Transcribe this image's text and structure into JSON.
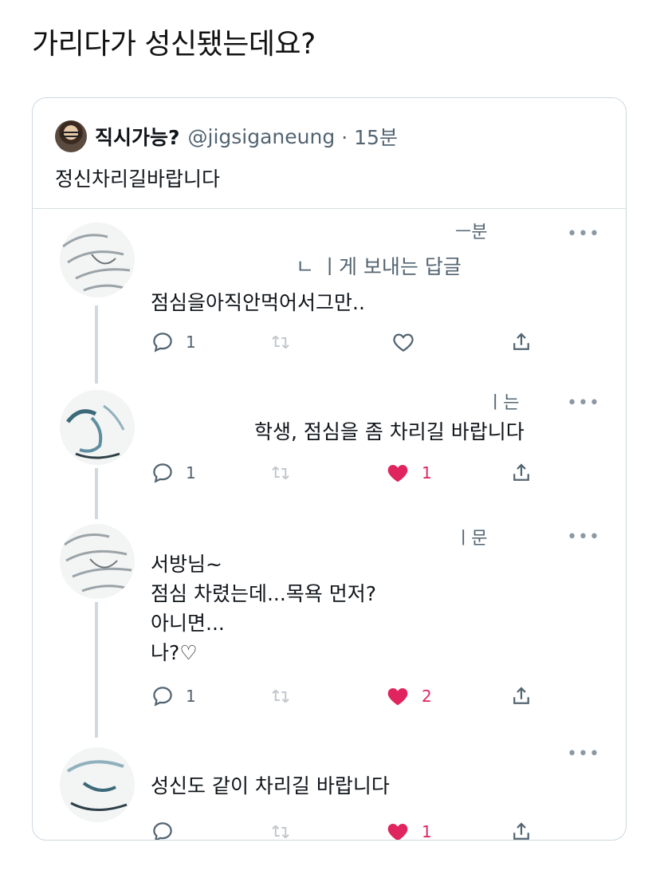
{
  "page_title": "가리다가 성신됐는데요?",
  "quoted_tweet": {
    "name": "직시가능?",
    "handle": "@jigsiganeung",
    "time": "· 15분",
    "text": "정신차리길바랍니다"
  },
  "replies": [
    {
      "time_fragment": "ㅡ분",
      "meta_line": "ㄴ ㅣ게 보내는 답글",
      "text": "점심을아직안먹어서그만..",
      "reply_count": "1",
      "like_count": "",
      "liked": false
    },
    {
      "time_fragment": "ㅣ는",
      "meta_line": "",
      "text": "학생, 점심을 좀 차리길 바랍니다",
      "reply_count": "1",
      "like_count": "1",
      "liked": true
    },
    {
      "time_fragment": "ㅣ문",
      "meta_line": "",
      "text": "서방님~\n점심 차렸는데...목욕 먼저?\n아니면...\n나?♡",
      "reply_count": "1",
      "like_count": "2",
      "liked": true
    },
    {
      "time_fragment": "",
      "meta_line": "",
      "text": "성신도 같이 차리길 바랍니다",
      "reply_count": "",
      "like_count": "1",
      "liked": true
    }
  ],
  "icons": {
    "reply": "reply-icon",
    "retweet": "retweet-icon",
    "like": "heart-icon",
    "share": "share-icon",
    "more": "more-icon"
  },
  "colors": {
    "like_active": "#e0245e",
    "icon_grey": "#536471",
    "border": "#cfd9de"
  },
  "more_glyph": "•••"
}
